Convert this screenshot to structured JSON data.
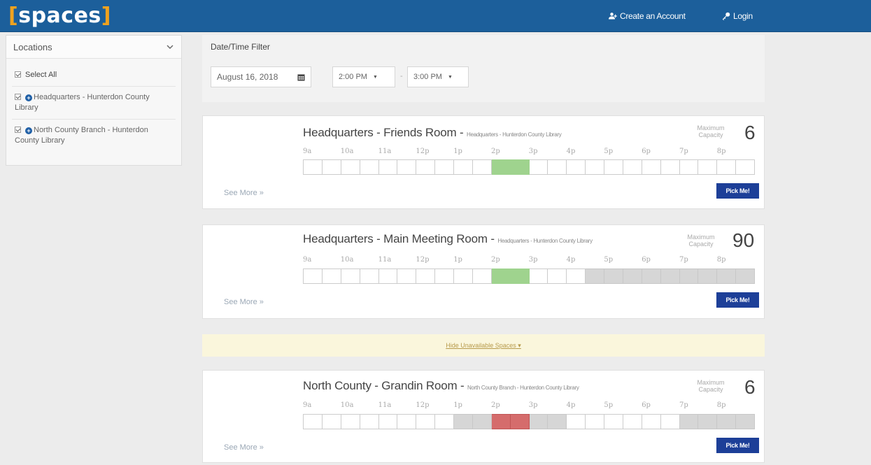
{
  "header": {
    "logo_text": "spaces",
    "create_account": "Create an Account",
    "login": "Login",
    "brand_color": "#1c5f9b",
    "logo_bracket_color": "#f0a21e"
  },
  "sidebar": {
    "title": "Locations",
    "items": [
      {
        "label": "Select All",
        "checked": true
      },
      {
        "label": "Headquarters - Hunterdon County Library",
        "checked": true
      },
      {
        "label": "North County Branch - Hunterdon County Library",
        "checked": true
      }
    ]
  },
  "filter": {
    "title": "Date/Time Filter",
    "date": "August 16, 2018",
    "start_time": "2:00 PM",
    "end_time": "3:00 PM",
    "separator": "-"
  },
  "hours": [
    "9a",
    "10a",
    "11a",
    "12p",
    "1p",
    "2p",
    "3p",
    "4p",
    "5p",
    "6p",
    "7p",
    "8p"
  ],
  "rooms": [
    {
      "title": "Headquarters - Friends Room -",
      "location": "Headquarters - Hunterdon County Library",
      "capacity_label": "Maximum Capacity",
      "capacity": "6",
      "see_more": "See More »",
      "pick_label": "Pick Me!",
      "slots": [
        "",
        "",
        "",
        "",
        "",
        "",
        "",
        "",
        "",
        "",
        "s",
        "s",
        "",
        "",
        "",
        "",
        "",
        "",
        "",
        "",
        "",
        "",
        "",
        ""
      ]
    },
    {
      "title": "Headquarters - Main Meeting Room -",
      "location": "Headquarters - Hunterdon County Library",
      "capacity_label": "Maximum Capacity",
      "capacity": "90",
      "see_more": "See More »",
      "pick_label": "Pick Me!",
      "slots": [
        "",
        "",
        "",
        "",
        "",
        "",
        "",
        "",
        "",
        "",
        "s",
        "s",
        "",
        "",
        "",
        "b",
        "b",
        "b",
        "b",
        "b",
        "b",
        "b",
        "b",
        "b"
      ]
    },
    {
      "title": "North County - Grandin Room -",
      "location": "North County Branch - Hunterdon County Library",
      "capacity_label": "Maximum Capacity",
      "capacity": "6",
      "see_more": "See More »",
      "pick_label": "Pick Me!",
      "slots": [
        "",
        "",
        "",
        "",
        "",
        "",
        "",
        "",
        "b",
        "b",
        "c",
        "c",
        "b",
        "b",
        "",
        "",
        "",
        "",
        "",
        "",
        "b",
        "b",
        "b",
        "b"
      ]
    }
  ],
  "hide_unavailable": "Hide Unavailable Spaces"
}
